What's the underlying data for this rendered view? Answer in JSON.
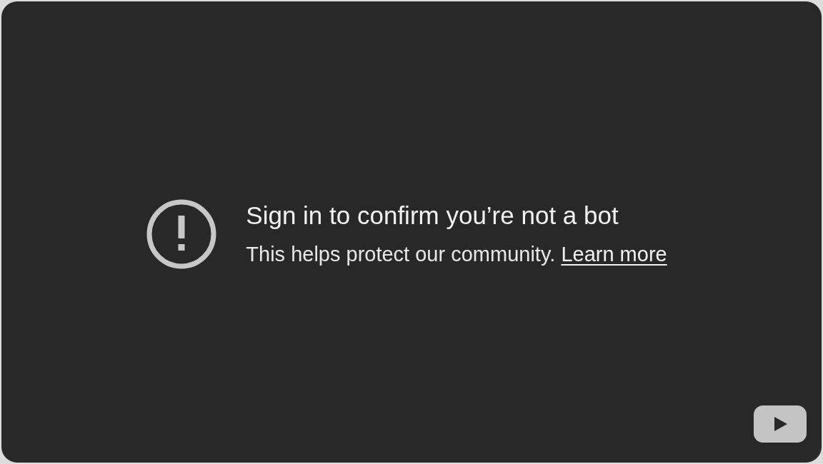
{
  "message": {
    "title": "Sign in to confirm you’re not a bot",
    "text": "This helps protect our community.",
    "link": "Learn more"
  }
}
